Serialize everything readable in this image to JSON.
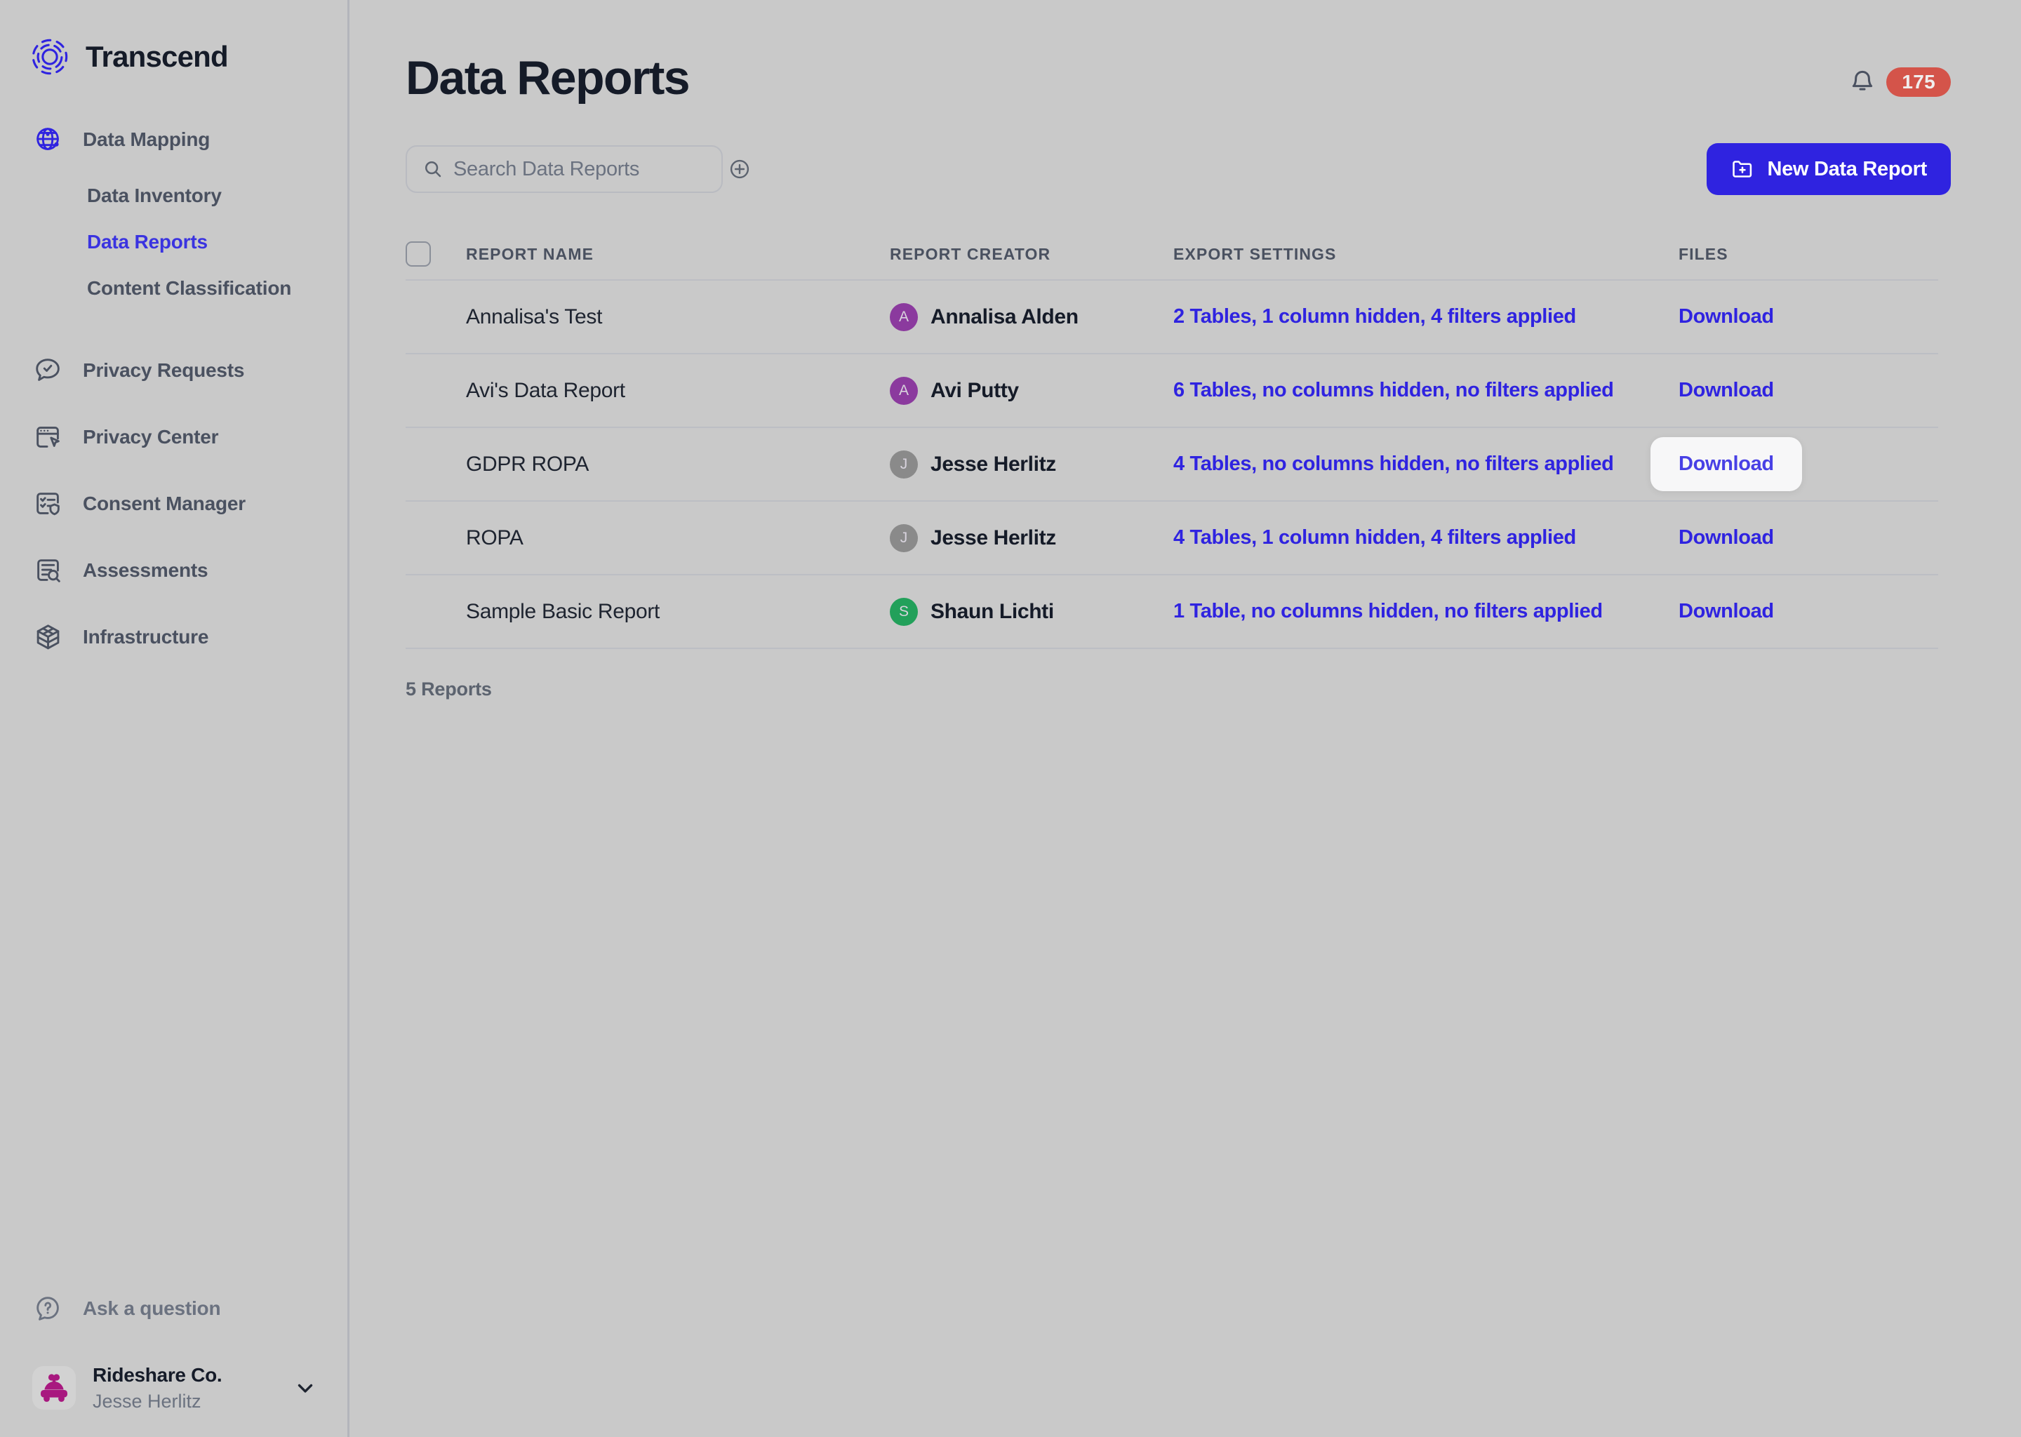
{
  "brand": {
    "name": "Transcend",
    "logo_icon": "transcend-logo-icon",
    "accent_color": "#2f23e0"
  },
  "sidebar": {
    "groups": [
      {
        "label": "Data Mapping",
        "icon": "globe-icon",
        "items": [
          {
            "label": "Data Inventory",
            "active": false
          },
          {
            "label": "Data Reports",
            "active": true
          },
          {
            "label": "Content Classification",
            "active": false
          }
        ]
      }
    ],
    "items": [
      {
        "label": "Privacy Requests",
        "icon": "chat-check-icon"
      },
      {
        "label": "Privacy Center",
        "icon": "browser-cursor-icon"
      },
      {
        "label": "Consent Manager",
        "icon": "checklist-shield-icon"
      },
      {
        "label": "Assessments",
        "icon": "document-search-icon"
      },
      {
        "label": "Infrastructure",
        "icon": "cube-icon"
      }
    ],
    "help": {
      "label": "Ask a question",
      "icon": "question-circle-icon"
    },
    "org": {
      "name": "Rideshare Co.",
      "user": "Jesse Herlitz",
      "avatar_icon": "car-icon",
      "avatar_color": "#a8187f",
      "chevron_icon": "chevron-down-icon"
    }
  },
  "header": {
    "title": "Data Reports",
    "notifications": {
      "icon": "bell-icon",
      "count": "175",
      "badge_color": "#d4544a"
    }
  },
  "toolbar": {
    "search": {
      "placeholder": "Search Data Reports",
      "value": "",
      "icon": "search-icon",
      "add_icon": "plus-circle-icon"
    },
    "new_report": {
      "label": "New Data Report",
      "icon": "folder-plus-icon"
    }
  },
  "table": {
    "select_all_checkbox": "unchecked",
    "columns": [
      "REPORT NAME",
      "REPORT CREATOR",
      "EXPORT SETTINGS",
      "FILES"
    ],
    "rows": [
      {
        "name": "Annalisa's Test",
        "creator": "Annalisa Alden",
        "creator_initial": "A",
        "avatar_color": "#8b3a9e",
        "export_settings": "2 Tables, 1 column hidden, 4 filters applied",
        "files_action": "Download",
        "hovered": false
      },
      {
        "name": "Avi's Data Report",
        "creator": "Avi Putty",
        "creator_initial": "A",
        "avatar_color": "#8b3a9e",
        "export_settings": "6 Tables, no columns hidden, no filters applied",
        "files_action": "Download",
        "hovered": false
      },
      {
        "name": "GDPR ROPA",
        "creator": "Jesse Herlitz",
        "creator_initial": "J",
        "avatar_color": "#8a8a8a",
        "export_settings": "4 Tables, no columns hidden, no filters applied",
        "files_action": "Download",
        "hovered": true
      },
      {
        "name": "ROPA",
        "creator": "Jesse Herlitz",
        "creator_initial": "J",
        "avatar_color": "#8a8a8a",
        "export_settings": "4 Tables, 1 column hidden, 4 filters applied",
        "files_action": "Download",
        "hovered": false
      },
      {
        "name": "Sample Basic Report",
        "creator": "Shaun Lichti",
        "creator_initial": "S",
        "avatar_color": "#22a05a",
        "export_settings": "1 Table, no columns hidden, no filters applied",
        "files_action": "Download",
        "hovered": false
      }
    ],
    "footer_count": "5 Reports"
  }
}
